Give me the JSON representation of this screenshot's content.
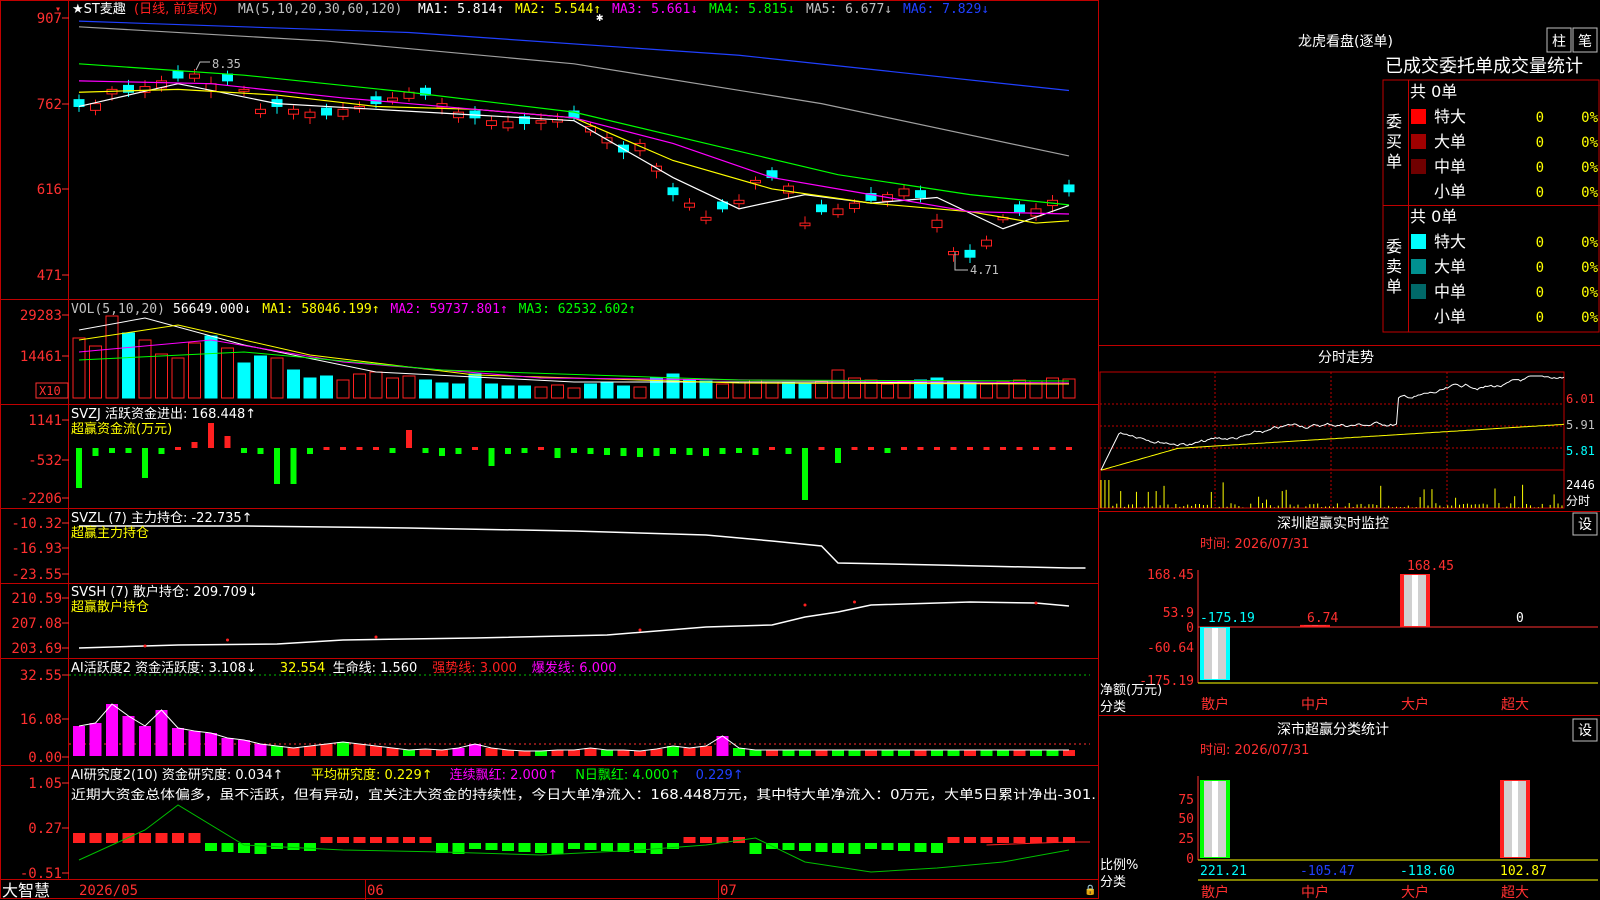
{
  "colors": {
    "up": "#ff2020",
    "down": "#00ffff",
    "grid": "#c00000",
    "axis": "#ff3030",
    "yellow": "#ffff00",
    "white": "#ffffff",
    "magenta": "#ff00ff",
    "green": "#00ff00",
    "blue": "#2040ff",
    "gray": "#a0a0a0"
  },
  "kline": {
    "title_prefix": "★ST麦趣",
    "title_period": "(日线, 前复权)",
    "ma_label": "MA(5,10,20,30,60,120)",
    "ma_items": [
      {
        "text": "MA1: 5.814↑",
        "color": "#ffffff"
      },
      {
        "text": "MA2: 5.544↑",
        "color": "#ffff00"
      },
      {
        "text": "MA3: 5.661↓",
        "color": "#ff00ff"
      },
      {
        "text": "MA4: 5.815↓",
        "color": "#00ff00"
      },
      {
        "text": "MA5: 6.677↓",
        "color": "#c0c0c0"
      },
      {
        "text": "MA6: 7.829↓",
        "color": "#2040ff"
      }
    ],
    "y_ticks": [
      "907",
      "762",
      "616",
      "471"
    ],
    "high_label": "8.35",
    "low_label": "4.71",
    "star": "✱"
  },
  "vol": {
    "label": "VOL(5,10,20)",
    "items": [
      {
        "text": "56649.000↓",
        "color": "#ffffff"
      },
      {
        "text": "MA1: 58046.199↑",
        "color": "#ffff00"
      },
      {
        "text": "MA2: 59737.801↑",
        "color": "#ff00ff"
      },
      {
        "text": "MA3: 62532.602↑",
        "color": "#00ff00"
      }
    ],
    "y_ticks": [
      "29283",
      "14461"
    ],
    "unit_badge": "X10"
  },
  "svzj": {
    "line1": "SVZJ  活跃资金进出: 168.448↑",
    "line2": "超赢资金流(万元)",
    "y_ticks": [
      "1141",
      "-532",
      "-2206"
    ]
  },
  "svzl": {
    "line1": "SVZL (7) 主力持仓: -22.735↑",
    "line2": "超赢主力持仓",
    "y_ticks": [
      "-10.32",
      "-16.93",
      "-23.55"
    ]
  },
  "svsh": {
    "line1": "SVSH (7) 散户持仓: 209.709↓",
    "line2": "超赢散户持仓",
    "y_ticks": [
      "210.59",
      "207.08",
      "203.69"
    ]
  },
  "ai1": {
    "items": [
      {
        "text": "AI活跃度2 资金活跃度: 3.108↓",
        "color": "#ffffff"
      },
      {
        "text": "32.554",
        "color": "#ffff00"
      },
      {
        "text": "生命线: 1.560",
        "color": "#ffffff"
      },
      {
        "text": "强势线: 3.000",
        "color": "#ff2020"
      },
      {
        "text": "爆发线: 6.000",
        "color": "#ff00ff"
      }
    ],
    "y_ticks": [
      "32.55",
      "16.08",
      "0.00"
    ]
  },
  "ai2": {
    "items": [
      {
        "text": "AI研究度2(10) 资金研究度: 0.034↑",
        "color": "#ffffff"
      },
      {
        "text": "平均研究度: 0.229↑",
        "color": "#ffff00"
      },
      {
        "text": "连续飘红: 2.000↑",
        "color": "#ff00ff"
      },
      {
        "text": "N日飘红: 4.000↑",
        "color": "#00ff00"
      },
      {
        "text": "0.229↑",
        "color": "#2040ff"
      }
    ],
    "comment": "近期大资金总体偏多，虽不活跃，但有异动，宜关注大资金的持续性，今日大单净流入：168.448万元，其中特大单净流入：0万元，大单5日累计净出-301.",
    "y_ticks": [
      "1.05",
      "0.27",
      "-0.51"
    ]
  },
  "bottom": {
    "brand": "大智慧",
    "dates": [
      "2026/05",
      "06",
      "07"
    ]
  },
  "lhb": {
    "title": "龙虎看盘(逐单)",
    "btn1": "柱",
    "btn2": "笔",
    "subtitle": "已成交委托单成交量统计",
    "buy_side": "委买单",
    "sell_side": "委卖单",
    "buy_total": "共 0单",
    "sell_total": "共 0单",
    "buy_rows": [
      {
        "name": "特大",
        "val": "0",
        "pct": "0%",
        "color": "#ff0000"
      },
      {
        "name": "大单",
        "val": "0",
        "pct": "0%",
        "color": "#a00000"
      },
      {
        "name": "中单",
        "val": "0",
        "pct": "0%",
        "color": "#700000"
      },
      {
        "name": "小单",
        "val": "0",
        "pct": "0%",
        "color": ""
      }
    ],
    "sell_rows": [
      {
        "name": "特大",
        "val": "0",
        "pct": "0%",
        "color": "#00ffff"
      },
      {
        "name": "大单",
        "val": "0",
        "pct": "0%",
        "color": "#009090"
      },
      {
        "name": "中单",
        "val": "0",
        "pct": "0%",
        "color": "#006868"
      },
      {
        "name": "小单",
        "val": "0",
        "pct": "0%",
        "color": ""
      }
    ]
  },
  "fenshi": {
    "title": "分时走势",
    "prices": [
      "6.01",
      "5.91",
      "5.81"
    ],
    "vol_label": "2446",
    "time_label": "分时"
  },
  "sz_monitor": {
    "title": "深圳超赢实时监控",
    "btn": "设",
    "time": "时间: 2026/07/31",
    "y_ticks": [
      "168.45",
      "53.9",
      "0",
      "-60.64",
      "-175.19"
    ],
    "y_label": "净额(万元)",
    "x_label": "分类",
    "categories": [
      "散户",
      "中户",
      "大户",
      "超大"
    ],
    "values": [
      -175.19,
      6.74,
      168.45,
      0
    ],
    "value_labels": [
      "-175.19",
      "6.74",
      "168.45",
      "0"
    ]
  },
  "sz_class": {
    "title": "深市超赢分类统计",
    "btn": "设",
    "time": "时间: 2026/07/31",
    "y_ticks": [
      "75",
      "50",
      "25",
      "0"
    ],
    "y_label": "比例%",
    "x_label": "分类",
    "categories": [
      "散户",
      "中户",
      "大户",
      "超大"
    ],
    "value_labels": [
      "221.21",
      "-105.47",
      "-118.60",
      "102.87"
    ],
    "label_colors": [
      "#00ffff",
      "#2040ff",
      "#00ffff",
      "#ffff00"
    ]
  }
}
